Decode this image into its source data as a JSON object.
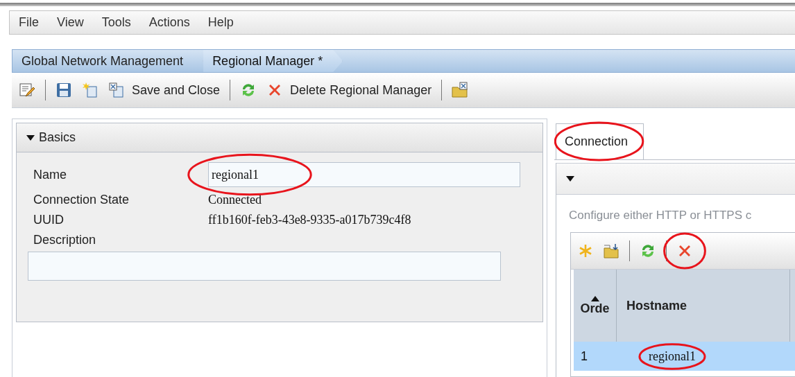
{
  "menu": [
    {
      "label": "File"
    },
    {
      "label": "View"
    },
    {
      "label": "Tools"
    },
    {
      "label": "Actions"
    },
    {
      "label": "Help"
    }
  ],
  "breadcrumbs": [
    {
      "label": "Global Network Management",
      "selected": false
    },
    {
      "label": "Regional Manager *",
      "selected": true
    }
  ],
  "toolbar": [
    {
      "kind": "edit"
    },
    {
      "kind": "save",
      "separator_before": true
    },
    {
      "kind": "new"
    },
    {
      "kind": "save-close",
      "label": "Save and Close"
    },
    {
      "kind": "refresh",
      "separator_before": true
    },
    {
      "kind": "delete",
      "label": "Delete Regional Manager"
    },
    {
      "kind": "folder-close",
      "separator_before": true
    }
  ],
  "basics": {
    "title": "Basics",
    "expanded": true,
    "fields": [
      {
        "kind": "input",
        "label": "Name",
        "value": "regional1",
        "circled": true
      },
      {
        "kind": "text",
        "label": "Connection State",
        "value": "Connected"
      },
      {
        "kind": "text",
        "label": "UUID",
        "value": "ff1b160f-feb3-43e8-9335-a017b739c4f8"
      },
      {
        "kind": "textarea",
        "label": "Description"
      }
    ]
  },
  "tabs": [
    {
      "label": "Connection",
      "selected": true,
      "circled": true
    }
  ],
  "connection": {
    "expanded": true,
    "hint": "Configure either HTTP or HTTPS c",
    "toolbar": [
      {
        "kind": "new"
      },
      {
        "kind": "import"
      },
      {
        "kind": "refresh",
        "separator_before": true
      },
      {
        "kind": "delete",
        "separator_before": true,
        "circled": true
      }
    ],
    "columns": [
      {
        "label": "Orde",
        "sorted": true
      },
      {
        "label": "Hostname"
      }
    ],
    "rows": [
      {
        "selected": true,
        "cells": [
          {
            "text": "1"
          },
          {
            "text": "regional1",
            "circled": true
          }
        ]
      }
    ]
  }
}
